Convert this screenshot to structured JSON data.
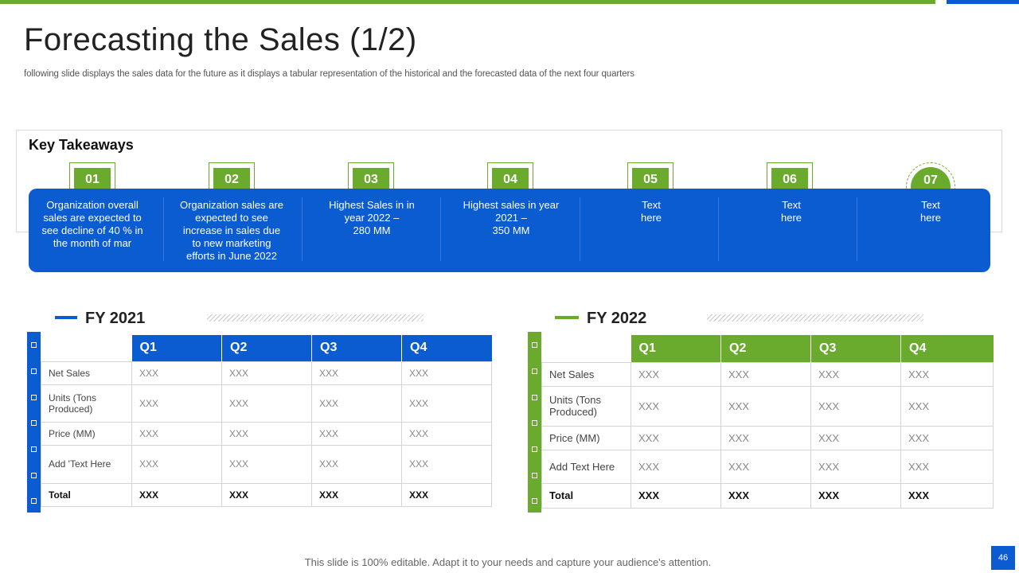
{
  "title": "Forecasting the Sales (1/2)",
  "subtitle": "following slide displays the sales data for the future as it displays a tabular representation of the historical and the forecasted data  of the next four quarters",
  "key_takeaways": {
    "heading": "Key Takeaways",
    "items": [
      {
        "num": "01",
        "lines": [
          "Organization overall",
          "sales are expected to",
          "see decline of 40 % in",
          "the month of mar"
        ]
      },
      {
        "num": "02",
        "lines": [
          "Organization sales are",
          "expected to see",
          "increase in sales due",
          "to new marketing",
          "efforts in June 2022"
        ]
      },
      {
        "num": "03",
        "lines": [
          "Highest Sales in in",
          "year 2022 –",
          "280 MM"
        ]
      },
      {
        "num": "04",
        "lines": [
          "Highest sales in year",
          "2021 –",
          "350 MM"
        ]
      },
      {
        "num": "05",
        "lines": [
          "Text",
          "here"
        ]
      },
      {
        "num": "06",
        "lines": [
          "Text",
          "here"
        ]
      },
      {
        "num": "07",
        "lines": [
          "Text",
          "here"
        ]
      }
    ]
  },
  "fy2021": {
    "title": "FY 2021",
    "headers": [
      "Q1",
      "Q2",
      "Q3",
      "Q4"
    ],
    "rows": [
      {
        "label": "Net Sales",
        "values": [
          "XXX",
          "XXX",
          "XXX",
          "XXX"
        ]
      },
      {
        "label": "Units (Tons Produced)",
        "values": [
          "XXX",
          "XXX",
          "XXX",
          "XXX"
        ]
      },
      {
        "label": "Price (MM)",
        "values": [
          "XXX",
          "XXX",
          "XXX",
          "XXX"
        ]
      },
      {
        "label": "Add 'Text Here",
        "values": [
          "XXX",
          "XXX",
          "XXX",
          "XXX"
        ]
      },
      {
        "label": "Total",
        "values": [
          "XXX",
          "XXX",
          "XXX",
          "XXX"
        ]
      }
    ]
  },
  "fy2022": {
    "title": "FY 2022",
    "headers": [
      "Q1",
      "Q2",
      "Q3",
      "Q4"
    ],
    "rows": [
      {
        "label": "Net Sales",
        "values": [
          "XXX",
          "XXX",
          "XXX",
          "XXX"
        ]
      },
      {
        "label": "Units (Tons Produced)",
        "values": [
          "XXX",
          "XXX",
          "XXX",
          "XXX"
        ]
      },
      {
        "label": "Price (MM)",
        "values": [
          "XXX",
          "XXX",
          "XXX",
          "XXX"
        ]
      },
      {
        "label": "Add Text Here",
        "values": [
          "XXX",
          "XXX",
          "XXX",
          "XXX"
        ]
      },
      {
        "label": "Total",
        "values": [
          "XXX",
          "XXX",
          "XXX",
          "XXX"
        ]
      }
    ]
  },
  "footer": "This slide is 100% editable. Adapt it to your needs and capture your audience's attention.",
  "page_number": "46",
  "colors": {
    "green": "#6aab2e",
    "blue": "#0b5bd1"
  }
}
